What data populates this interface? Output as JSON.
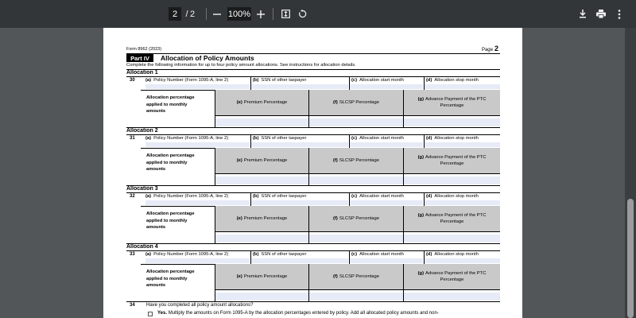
{
  "toolbar": {
    "current_page": "2",
    "page_separator": "/",
    "total_pages": "2",
    "zoom": "100%"
  },
  "form": {
    "form_id": "Form 8962 (2023)",
    "page_label": "Page",
    "page_number": "2",
    "part_label": "Part IV",
    "part_title": "Allocation of Policy Amounts",
    "part_instructions": "Complete the following information for up to four policy amount allocations. See instructions for allocation details."
  },
  "allocations": [
    {
      "title": "Allocation 1",
      "line": "30"
    },
    {
      "title": "Allocation 2",
      "line": "31"
    },
    {
      "title": "Allocation 3",
      "line": "32"
    },
    {
      "title": "Allocation 4",
      "line": "33"
    }
  ],
  "columns": {
    "a_letter": "(a)",
    "a_label": "Policy Number (Form 1095-A, line 2)",
    "b_letter": "(b)",
    "b_label": "SSN of other taxpayer",
    "c_letter": "(c)",
    "c_label": "Allocation start month",
    "d_letter": "(d)",
    "d_label": "Allocation stop month",
    "pct_label_1": "Allocation percentage",
    "pct_label_2": "applied to monthly",
    "pct_label_3": "amounts",
    "e_letter": "(e)",
    "e_label": "Premium Percentage",
    "f_letter": "(f)",
    "f_label": "SLCSP Percentage",
    "g_letter": "(g)",
    "g_label": "Advance Payment of the PTC Percentage"
  },
  "question34": {
    "number": "34",
    "text": "Have you completed all policy amount allocations?",
    "yes_label": "Yes.",
    "yes_text": "Multiply the amounts on Form 1095-A by the allocation percentages entered by policy. Add all allocated policy amounts and non-"
  }
}
